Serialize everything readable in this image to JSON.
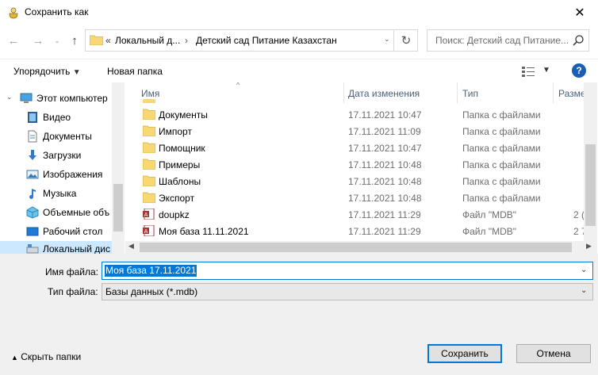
{
  "window": {
    "title": "Сохранить как"
  },
  "address": {
    "crumbs": [
      "«",
      "Локальный д...",
      "›",
      "Детский сад Питание Казахстан"
    ]
  },
  "search": {
    "placeholder": "Поиск: Детский сад Питание..."
  },
  "toolbar": {
    "organize": "Упорядочить",
    "new_folder": "Новая папка",
    "help": "?"
  },
  "nav": {
    "items": [
      {
        "label": "Этот компьютер",
        "icon": "computer-icon"
      },
      {
        "label": "Видео",
        "icon": "video-icon"
      },
      {
        "label": "Документы",
        "icon": "documents-icon"
      },
      {
        "label": "Загрузки",
        "icon": "downloads-icon"
      },
      {
        "label": "Изображения",
        "icon": "pictures-icon"
      },
      {
        "label": "Музыка",
        "icon": "music-icon"
      },
      {
        "label": "Объемные объ",
        "icon": "3d-objects-icon"
      },
      {
        "label": "Рабочий стол",
        "icon": "desktop-icon"
      },
      {
        "label": "Локальный дис",
        "icon": "local-disk-icon"
      }
    ]
  },
  "list": {
    "columns": [
      "Имя",
      "Дата изменения",
      "Тип",
      "Разме"
    ],
    "rows": [
      {
        "name": "Документы",
        "date": "17.11.2021 10:47",
        "type": "Папка с файлами",
        "size": "",
        "kind": "folder"
      },
      {
        "name": "Импорт",
        "date": "17.11.2021 11:09",
        "type": "Папка с файлами",
        "size": "",
        "kind": "folder"
      },
      {
        "name": "Помощник",
        "date": "17.11.2021 10:47",
        "type": "Папка с файлами",
        "size": "",
        "kind": "folder"
      },
      {
        "name": "Примеры",
        "date": "17.11.2021 10:48",
        "type": "Папка с файлами",
        "size": "",
        "kind": "folder"
      },
      {
        "name": "Шаблоны",
        "date": "17.11.2021 10:48",
        "type": "Папка с файлами",
        "size": "",
        "kind": "folder"
      },
      {
        "name": "Экспорт",
        "date": "17.11.2021 10:48",
        "type": "Папка с файлами",
        "size": "",
        "kind": "folder"
      },
      {
        "name": "doupkz",
        "date": "17.11.2021 11:29",
        "type": "Файл \"MDB\"",
        "size": "2 (",
        "kind": "mdb"
      },
      {
        "name": "Моя база 11.11.2021",
        "date": "17.11.2021 11:29",
        "type": "Файл \"MDB\"",
        "size": "2 7",
        "kind": "mdb"
      }
    ]
  },
  "form": {
    "filename_label": "Имя файла:",
    "filename_value": "Моя база 17.11.2021",
    "filetype_label": "Тип файла:",
    "filetype_value": "Базы данных (*.mdb)"
  },
  "footer": {
    "hide_folders": "Скрыть папки",
    "save": "Сохранить",
    "cancel": "Отмена"
  },
  "colors": {
    "accent": "#0078d7",
    "selection": "#cce8ff",
    "folder": "#f8d775"
  }
}
